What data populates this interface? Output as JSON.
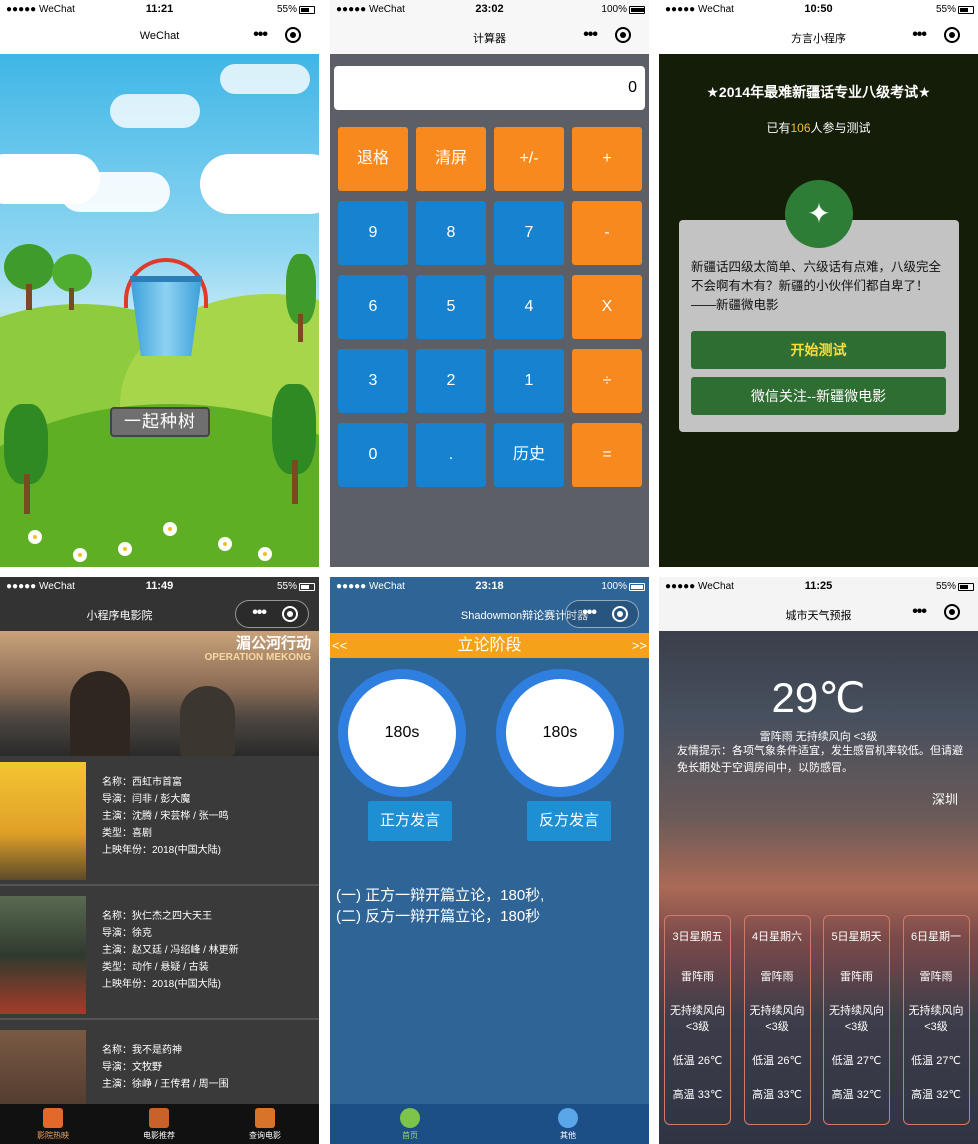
{
  "status_bars": [
    {
      "carrier": "●●●●● WeChat",
      "time": "11:21",
      "battery": "55%",
      "battery_level": 0.55
    },
    {
      "carrier": "●●●●● WeChat",
      "time": "23:02",
      "battery": "100%",
      "battery_level": 1.0
    },
    {
      "carrier": "●●●●● WeChat",
      "time": "10:50",
      "battery": "55%",
      "battery_level": 0.55
    },
    {
      "carrier": "●●●●● WeChat",
      "time": "11:49",
      "battery": "55%",
      "battery_level": 0.55
    },
    {
      "carrier": "●●●●● WeChat",
      "time": "23:18",
      "battery": "100%",
      "battery_level": 1.0
    },
    {
      "carrier": "●●●●● WeChat",
      "time": "11:25",
      "battery": "55%",
      "battery_level": 0.55
    }
  ],
  "titles": [
    "WeChat",
    "计算器",
    "方言小程序",
    "小程序电影院",
    "Shadowmon辩论赛计时器",
    "城市天气预报"
  ],
  "tree_app": {
    "button": "一起种树"
  },
  "calculator": {
    "display": "0",
    "keys": [
      [
        "退格",
        "清屏",
        "+/-",
        "+"
      ],
      [
        "9",
        "8",
        "7",
        "-"
      ],
      [
        "6",
        "5",
        "4",
        "X"
      ],
      [
        "3",
        "2",
        "1",
        "÷"
      ],
      [
        "0",
        ".",
        "历史",
        "="
      ]
    ]
  },
  "dialect": {
    "heading": "★2014年最难新疆话专业八级考试★",
    "count_prefix": "已有",
    "count": "106",
    "count_suffix": "人参与测试",
    "description": "新疆话四级太简单、六级话有点难，八级完全不会啊有木有？新疆的小伙伴们都自卑了！——新疆微电影",
    "start_button": "开始测试",
    "follow_button": "微信关注--新疆微电影"
  },
  "cinema": {
    "banner_logo": "湄公河行动",
    "banner_logo_en": "OPERATION MEKONG",
    "movies": [
      {
        "name": "名称：西虹市首富",
        "director": "导演：闫非 / 彭大魔",
        "cast": "主演：沈腾 / 宋芸桦 / 张一鸣",
        "genre": "类型：喜剧",
        "year": "上映年份：2018(中国大陆)"
      },
      {
        "name": "名称：狄仁杰之四大天王",
        "director": "导演：徐克",
        "cast": "主演：赵又廷 / 冯绍峰 / 林更新",
        "genre": "类型：动作 / 悬疑 / 古装",
        "year": "上映年份：2018(中国大陆)"
      },
      {
        "name": "名称：我不是药神",
        "director": "导演：文牧野",
        "cast": "主演：徐峥 / 王传君 / 周一围",
        "genre": "",
        "year": ""
      }
    ],
    "tabs": [
      "影院热映",
      "电影推荐",
      "查询电影"
    ]
  },
  "debate": {
    "prev": "<<",
    "stage": "立论阶段",
    "next": ">>",
    "timer_left": "180s",
    "timer_right": "180s",
    "btn_left": "正方发言",
    "btn_right": "反方发言",
    "log_1": "(一) 正方一辩开篇立论，180秒,",
    "log_2": "(二) 反方一辩开篇立论，180秒",
    "tabs": [
      "首页",
      "其他"
    ]
  },
  "weather": {
    "temp": "29℃",
    "condition": "雷阵雨 无持续风向 <3级",
    "tip": "友情提示：各项气象条件适宜，发生感冒机率较低。但请避免长期处于空调房间中，以防感冒。",
    "city": "深圳",
    "days": [
      {
        "date": "3日星期五",
        "weather": "雷阵雨",
        "wind1": "无持续风向",
        "wind2": "<3级",
        "low": "低温 26℃",
        "high": "高温 33℃"
      },
      {
        "date": "4日星期六",
        "weather": "雷阵雨",
        "wind1": "无持续风向",
        "wind2": "<3级",
        "low": "低温 26℃",
        "high": "高温 33℃"
      },
      {
        "date": "5日星期天",
        "weather": "雷阵雨",
        "wind1": "无持续风向",
        "wind2": "<3级",
        "low": "低温 27℃",
        "high": "高温 32℃"
      },
      {
        "date": "6日星期一",
        "weather": "雷阵雨",
        "wind1": "无持续风向",
        "wind2": "<3级",
        "low": "低温 27℃",
        "high": "高温 32℃"
      }
    ]
  },
  "colors": {
    "orange": "#f7891f",
    "blue": "#1682d0",
    "green": "#2f6e33",
    "debate_bg": "#2f6496",
    "stage_bar": "#f5a21a"
  }
}
